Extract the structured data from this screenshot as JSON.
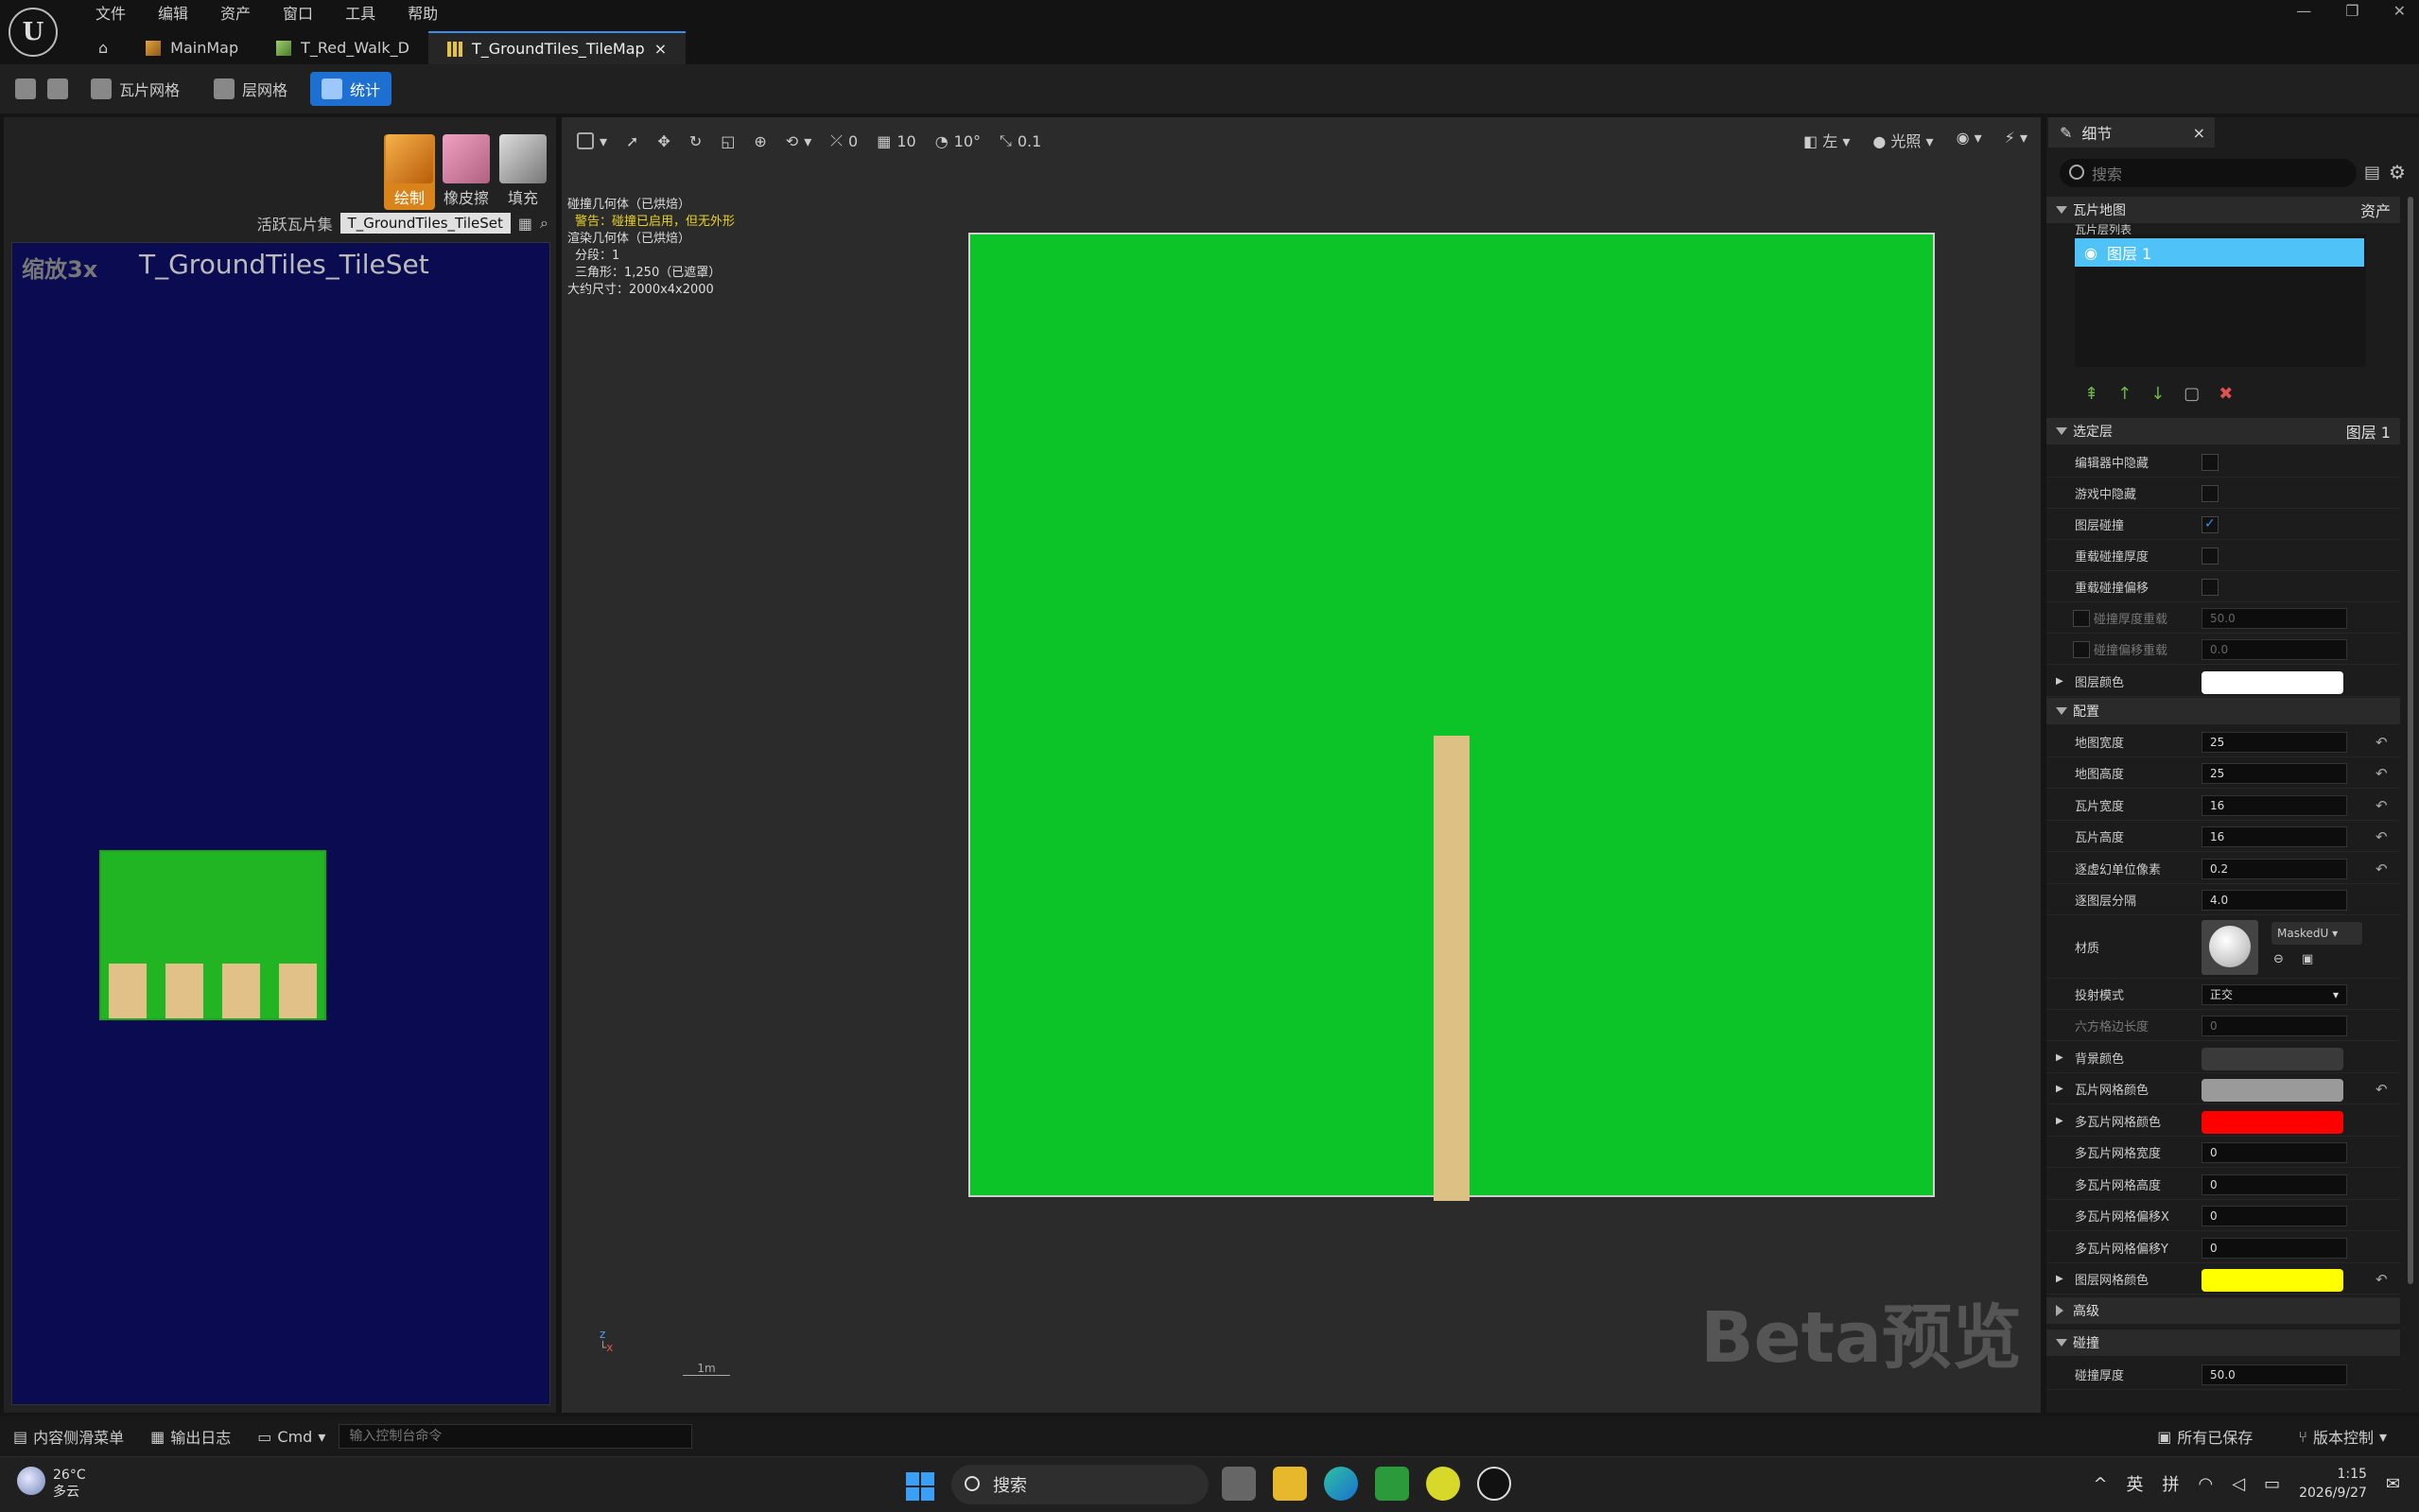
{
  "menu": [
    "文件",
    "编辑",
    "资产",
    "窗口",
    "工具",
    "帮助"
  ],
  "tabs": [
    {
      "label": "MainMap",
      "active": false
    },
    {
      "label": "T_Red_Walk_D",
      "active": false
    },
    {
      "label": "T_GroundTiles_TileMap",
      "active": true
    }
  ],
  "toolbar": {
    "tile_grid": "瓦片网格",
    "layer_grid": "层网格",
    "stats": "统计"
  },
  "tools": {
    "paint": "绘制",
    "eraser": "橡皮擦",
    "fill": "填充"
  },
  "tileset": {
    "active_label": "活跃瓦片集",
    "active_value": "T_GroundTiles_TileSet",
    "zoom": "缩放3x",
    "name": "T_GroundTiles_TileSet"
  },
  "viewport": {
    "snap_angle": "0",
    "snap_grid": "10",
    "snap_rot": "10°",
    "snap_scale": "0.1",
    "view_mode": "左",
    "lighting": "光照",
    "stats": [
      {
        "text": "碰撞几何体（已烘焙）",
        "warn": false
      },
      {
        "text": "警告：碰撞已启用，但无外形",
        "warn": true
      },
      {
        "text": "渲染几何体（已烘焙）",
        "warn": false
      },
      {
        "text": "分段：1",
        "warn": false
      },
      {
        "text": "三角形：1,250（已遮罩）",
        "warn": false
      },
      {
        "text": "大约尺寸：2000x4x2000",
        "warn": false
      }
    ],
    "scale_label": "1m",
    "beta": "Beta预览"
  },
  "details": {
    "tab": "细节",
    "search_placeholder": "搜索",
    "tilemap_section": "瓦片地图",
    "asset_label": "资产",
    "layer_list_label": "瓦片层列表",
    "layer_name": "图层 1",
    "selected_layer_section": "选定层",
    "selected_layer_value": "图层 1",
    "hide_in_editor": "编辑器中隐藏",
    "hide_in_game": "游戏中隐藏",
    "layer_collision": "图层碰撞",
    "override_thickness": "重载碰撞厚度",
    "override_offset": "重载碰撞偏移",
    "collision_thickness_override": "碰撞厚度重载",
    "collision_thickness_override_val": "50.0",
    "collision_offset_override": "碰撞偏移重载",
    "collision_offset_override_val": "0.0",
    "layer_color": "图层颜色",
    "config_section": "配置",
    "map_width": "地图宽度",
    "map_width_val": "25",
    "map_height": "地图高度",
    "map_height_val": "25",
    "tile_width": "瓦片宽度",
    "tile_width_val": "16",
    "tile_height": "瓦片高度",
    "tile_height_val": "16",
    "ppu": "逐虚幻单位像素",
    "ppu_val": "0.2",
    "layer_sep": "逐图层分隔",
    "layer_sep_val": "4.0",
    "material": "材质",
    "material_val": "MaskedU",
    "projection": "投射模式",
    "projection_val": "正交",
    "hex_side": "六方格边长度",
    "hex_side_val": "0",
    "bg_color": "背景颜色",
    "grid_color": "瓦片网格颜色",
    "multi_grid_color": "多瓦片网格颜色",
    "multi_grid_width": "多瓦片网格宽度",
    "multi_grid_width_val": "0",
    "multi_grid_height": "多瓦片网格高度",
    "multi_grid_height_val": "0",
    "multi_grid_offx": "多瓦片网格偏移X",
    "multi_grid_offx_val": "0",
    "multi_grid_offy": "多瓦片网格偏移Y",
    "multi_grid_offy_val": "0",
    "layer_grid_color": "图层网格颜色",
    "advanced_section": "高级",
    "collision_section": "碰撞",
    "collision_thickness": "碰撞厚度",
    "collision_thickness_val": "50.0"
  },
  "colors": {
    "layer_color": "#ffffff",
    "bg_color": "#3a3a3a",
    "grid_color": "#9a9a9a",
    "multi_grid_color": "#ff0000",
    "layer_grid_color": "#ffff00",
    "accent": "#1d6fd1",
    "tilemap_green": "#0cc428"
  },
  "status": {
    "content_drawer": "内容侧滑菜单",
    "output_log": "输出日志",
    "cmd": "Cmd",
    "console_placeholder": "输入控制台命令",
    "saved": "所有已保存",
    "source_control": "版本控制"
  },
  "taskbar": {
    "temp": "26°C",
    "weather": "多云",
    "search": "搜索",
    "ime1": "英",
    "ime2": "拼",
    "time": "1:15",
    "date": "2026/9/27"
  }
}
